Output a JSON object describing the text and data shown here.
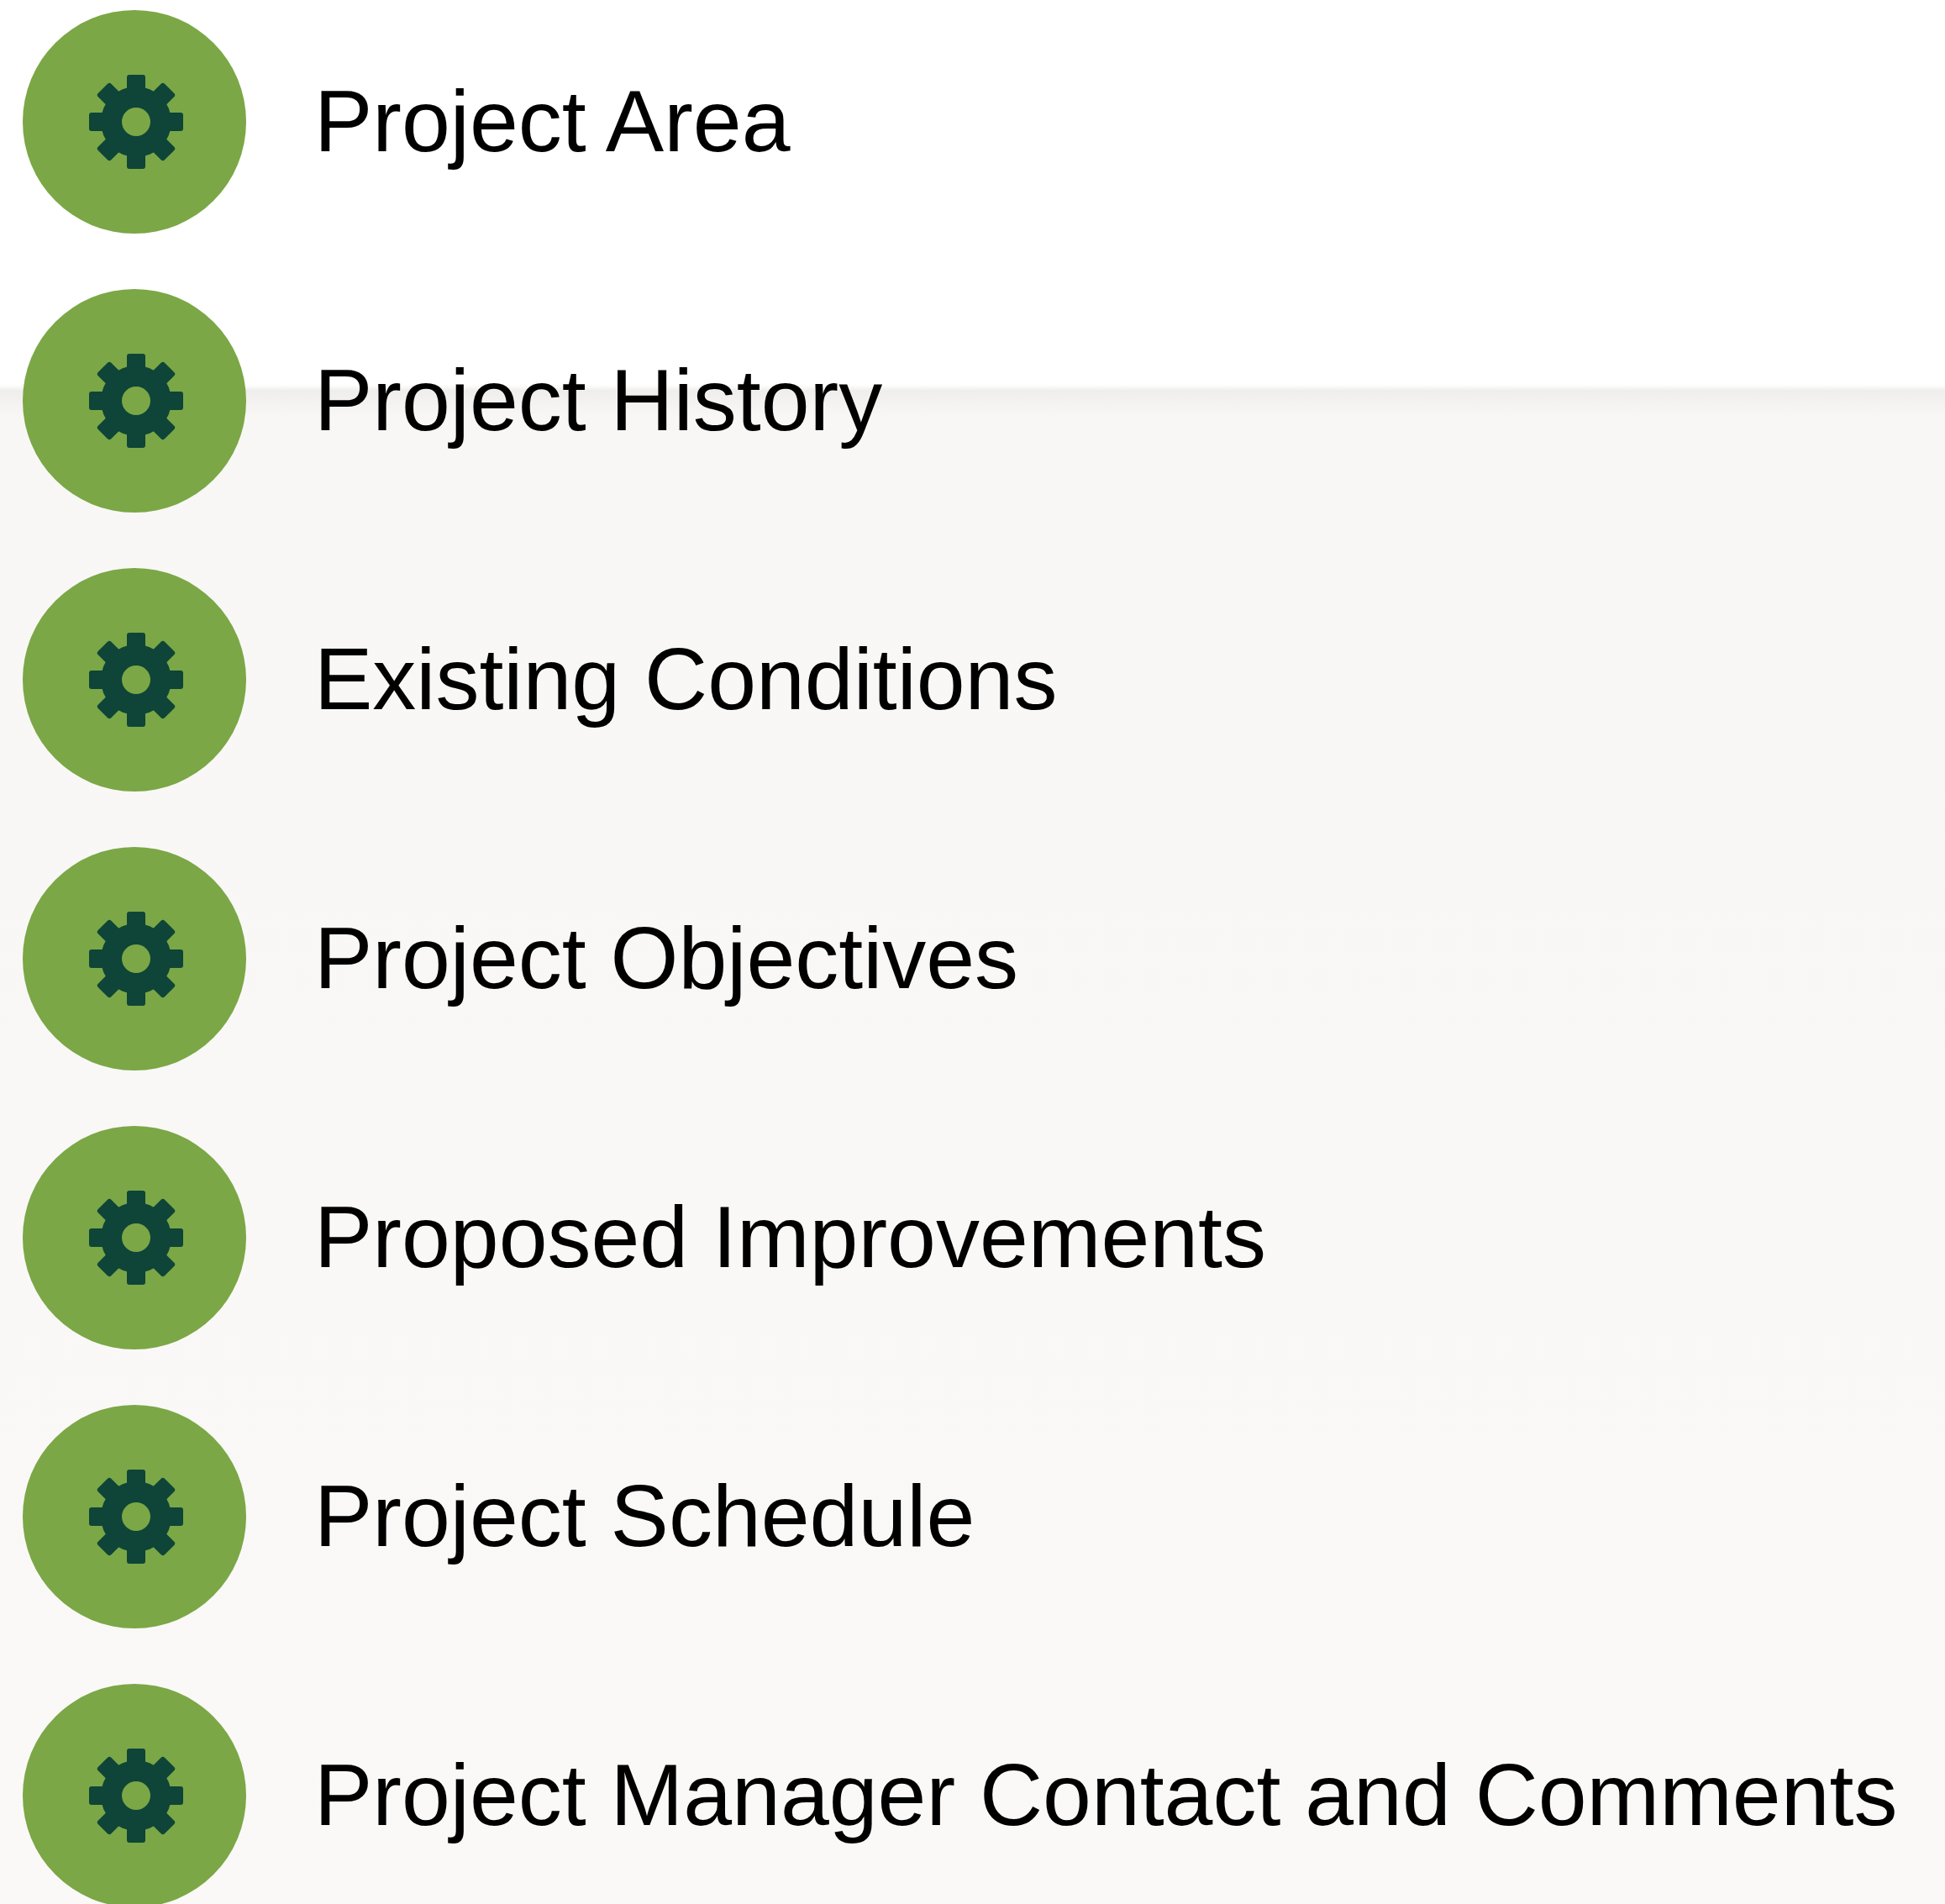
{
  "sections": [
    {
      "label": "Project Area"
    },
    {
      "label": "Project History"
    },
    {
      "label": "Existing Conditions"
    },
    {
      "label": "Project Objectives"
    },
    {
      "label": "Proposed Improvements"
    },
    {
      "label": "Project Schedule"
    },
    {
      "label": "Project Manager Contact and Comments"
    }
  ]
}
